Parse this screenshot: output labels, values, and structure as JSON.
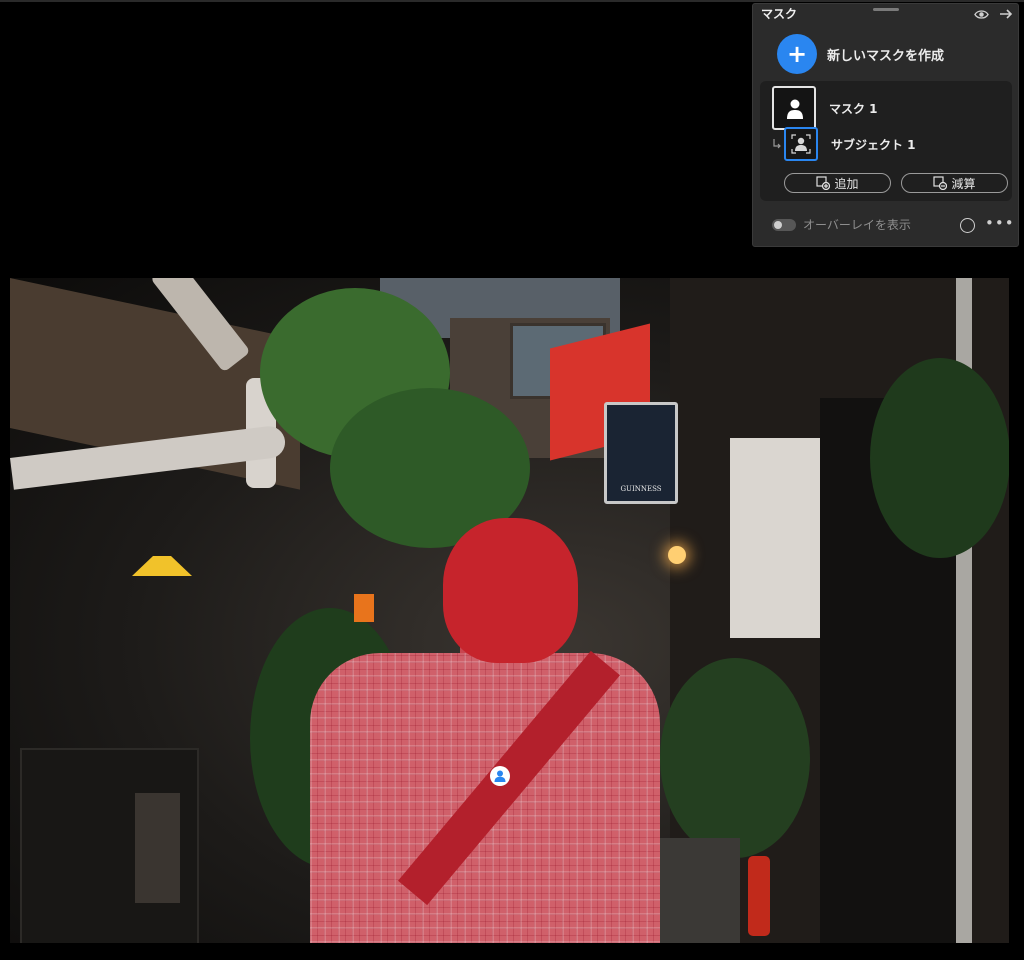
{
  "panel": {
    "title": "マスク",
    "new_mask_label": "新しいマスクを作成",
    "mask_name": "マスク 1",
    "subject_name": "サブジェクト 1",
    "add_label": "追加",
    "subtract_label": "減算",
    "overlay_label": "オーバーレイを表示",
    "overlay_enabled": false,
    "icons": [
      "eye-icon",
      "arrow-right-icon",
      "plus-icon",
      "person-icon",
      "link-icon",
      "add-mask-icon",
      "subtract-mask-icon",
      "circle-icon",
      "more-icon"
    ],
    "accent_color": "#2a86f0"
  },
  "photo": {
    "sign_text": "GUINNESS",
    "overlay_color": "#c6242c"
  }
}
